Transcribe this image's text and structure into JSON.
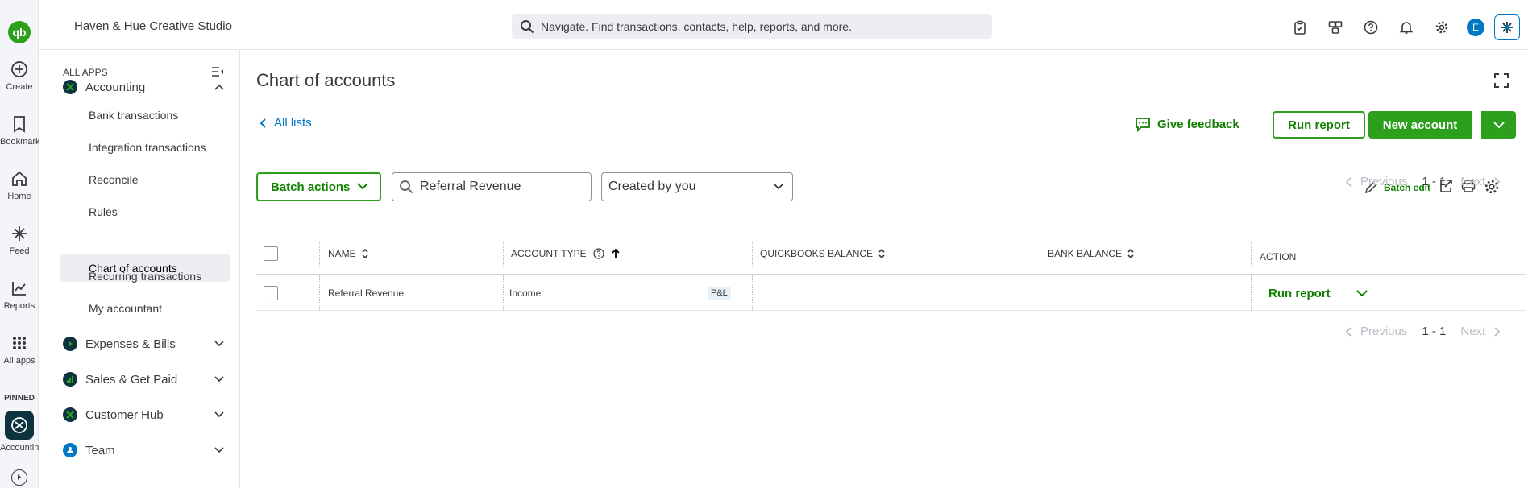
{
  "rail": {
    "logo": "qb",
    "items": [
      {
        "label": "Create",
        "icon": "plus-circle-icon"
      },
      {
        "label": "Bookmarks",
        "icon": "bookmark-icon"
      },
      {
        "label": "Home",
        "icon": "home-icon"
      },
      {
        "label": "Feed",
        "icon": "sparkle-icon"
      },
      {
        "label": "Reports",
        "icon": "chart-line-icon"
      },
      {
        "label": "All apps",
        "icon": "grid-icon"
      }
    ],
    "pinned_label": "PINNED",
    "pinned_app": "Accounting"
  },
  "topbar": {
    "company": "Haven & Hue Creative Studio",
    "search_placeholder": "Navigate. Find transactions, contacts, help, reports, and more.",
    "avatar_initial": "E"
  },
  "sidebar": {
    "header": "ALL APPS",
    "accounting_label": "Accounting",
    "items": [
      "Bank transactions",
      "Integration transactions",
      "Reconcile",
      "Rules",
      "Chart of accounts",
      "Recurring transactions",
      "My accountant"
    ],
    "sections": [
      "Expenses & Bills",
      "Sales & Get Paid",
      "Customer Hub",
      "Team"
    ]
  },
  "main": {
    "title": "Chart of accounts",
    "back_link": "All lists",
    "feedback": "Give feedback",
    "run_report": "Run report",
    "new_account": "New account",
    "batch_actions": "Batch actions",
    "filter_value": "Referral Revenue",
    "filter_select": "Created by you",
    "batch_edit": "Batch edit",
    "pager": {
      "previous": "Previous",
      "range": "1 - 1",
      "next": "Next"
    }
  },
  "table": {
    "headers": [
      "NAME",
      "ACCOUNT TYPE",
      "QUICKBOOKS BALANCE",
      "BANK BALANCE",
      "ACTION"
    ],
    "rows": [
      {
        "name": "Referral Revenue",
        "type": "Income",
        "badge": "P&L",
        "qb_balance": "",
        "bank_balance": "",
        "action": "Run report"
      }
    ]
  },
  "colors": {
    "accent_green": "#2ca01c",
    "link_blue": "#0077c5"
  }
}
